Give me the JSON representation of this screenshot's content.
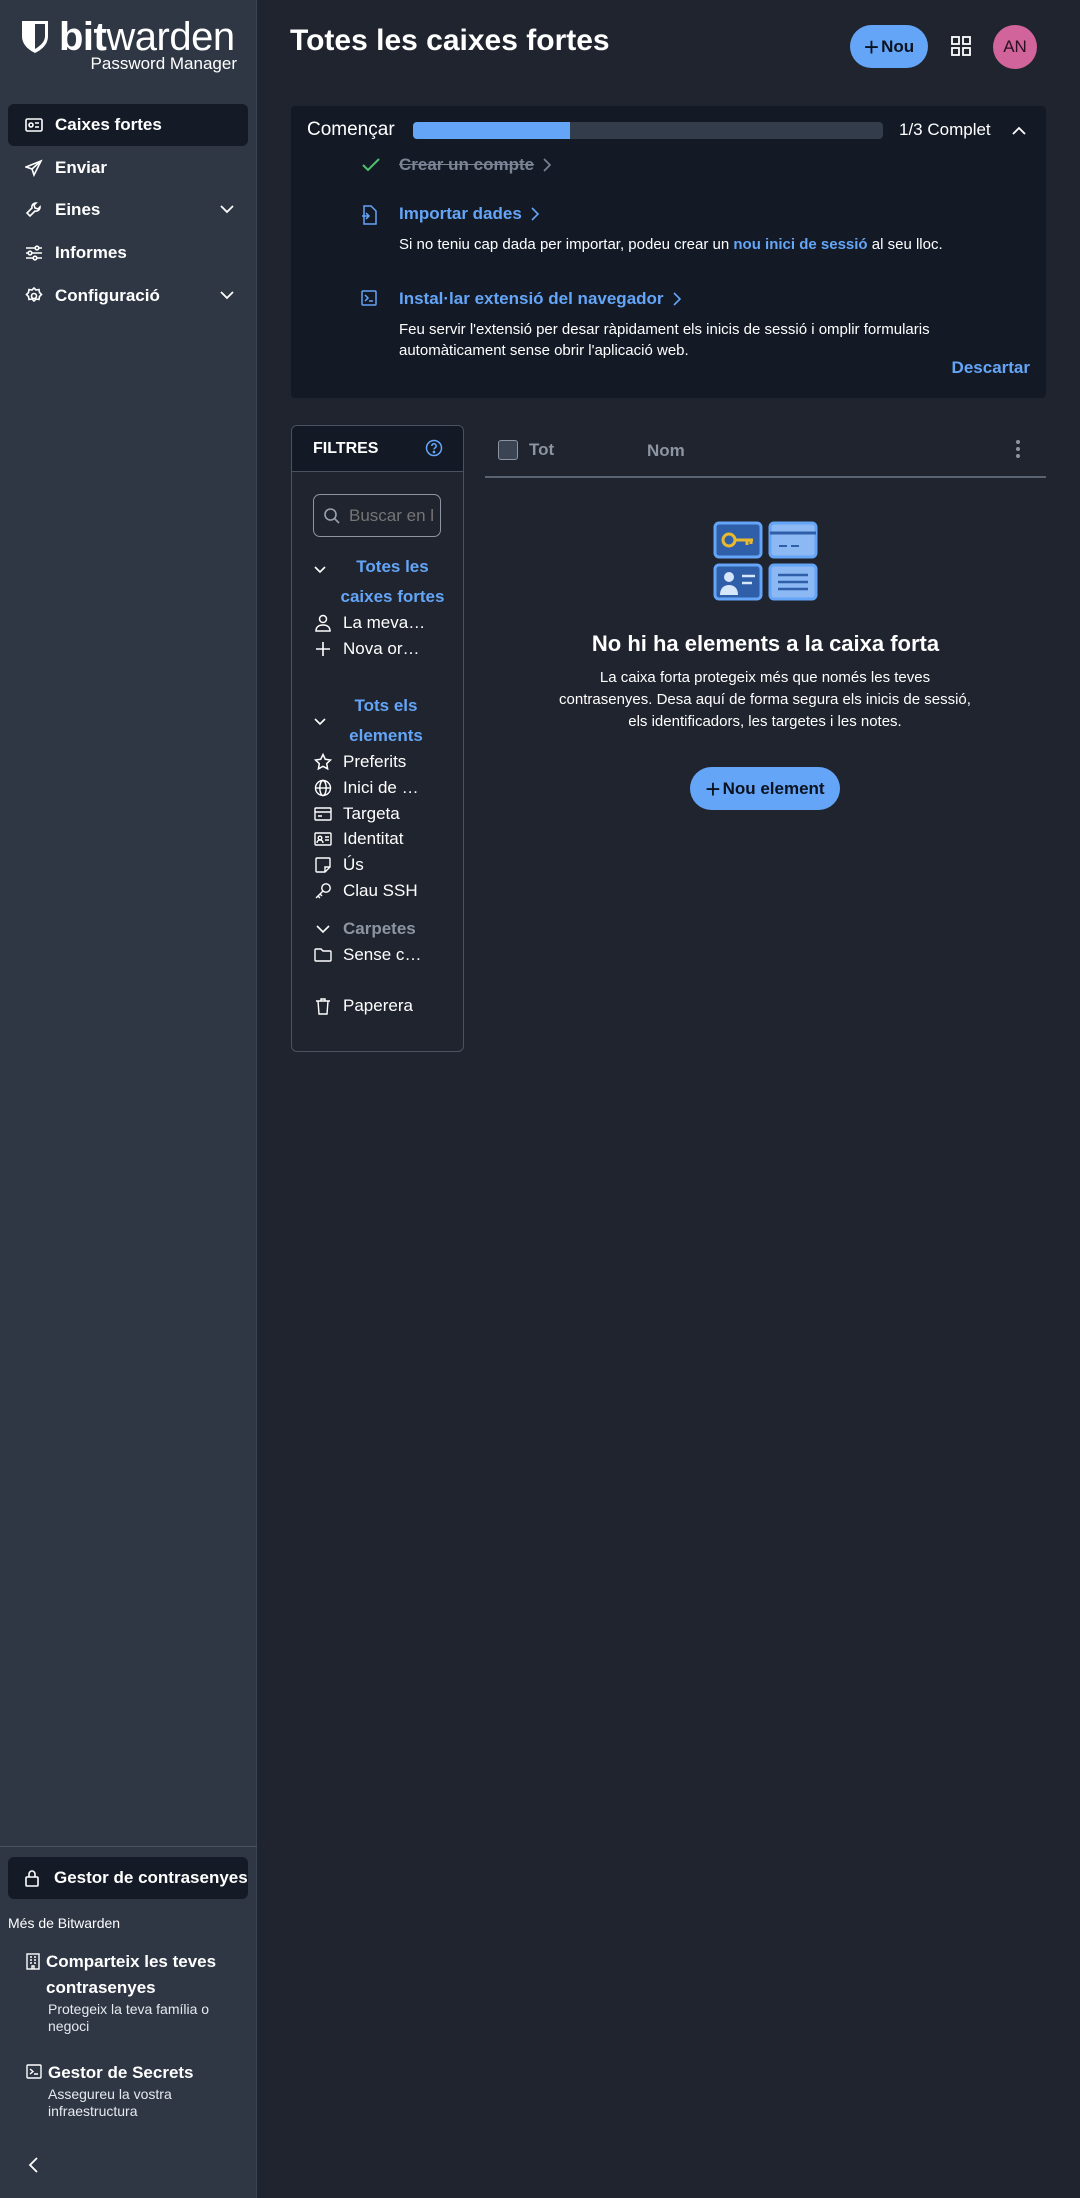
{
  "colors": {
    "accent": "#64a5f7",
    "sidebar": "#2f3744",
    "background": "#1f242e",
    "avatar": "#d0649b",
    "success": "#4fc06d"
  },
  "brand": {
    "word_bold": "bit",
    "word_light": "warden",
    "subtitle": "Password Manager",
    "icon": "shield-icon"
  },
  "sidebar": {
    "items": [
      {
        "label": "Caixes fortes",
        "icon": "vault-icon",
        "active": true
      },
      {
        "label": "Enviar",
        "icon": "send-icon"
      },
      {
        "label": "Eines",
        "icon": "wrench-icon",
        "expandable": true
      },
      {
        "label": "Informes",
        "icon": "sliders-icon"
      },
      {
        "label": "Configuració",
        "icon": "gear-icon",
        "expandable": true
      }
    ],
    "product_switcher": "Gestor de contrasenyes",
    "more_title": "Més de Bitwarden",
    "promos": [
      {
        "title": "Comparteix les teves contrasenyes",
        "desc": "Protegeix la teva família o negoci",
        "icon": "building-icon"
      },
      {
        "title": "Gestor de Secrets",
        "desc": "Assegureu la vostra infraestructura",
        "icon": "terminal-icon"
      }
    ]
  },
  "header": {
    "title": "Totes les caixes fortes",
    "new_label": "Nou",
    "avatar_initials": "AN"
  },
  "onboarding": {
    "title": "Començar",
    "progress": 0.333,
    "progress_label": "1/3 Complet",
    "tasks": [
      {
        "title": "Crear un compte",
        "done": true
      },
      {
        "title": "Importar dades",
        "desc_before": "Si no teniu cap dada per importar, podeu crear un ",
        "desc_link": "nou inici de sessió",
        "desc_after": " al seu lloc."
      },
      {
        "title": "Instal·lar extensió del navegador",
        "desc": "Feu servir l'extensió per desar ràpidament els inicis de sessió i omplir formularis automàticament sense obrir l'aplicació web."
      }
    ],
    "dismiss": "Descartar"
  },
  "filters": {
    "title": "FILTRES",
    "search_placeholder": "Buscar en la caixa forta",
    "vaults_header": "Totes les caixes fortes",
    "vaults": [
      {
        "label": "La meva caixa forta",
        "icon": "user-icon"
      },
      {
        "label": "Nova organització",
        "icon": "plus-icon"
      }
    ],
    "items_header": "Tots els elements",
    "types": [
      {
        "label": "Preferits",
        "icon": "star-icon"
      },
      {
        "label": "Inici de sessió",
        "icon": "globe-icon"
      },
      {
        "label": "Targeta",
        "icon": "card-icon"
      },
      {
        "label": "Identitat",
        "icon": "id-card-icon"
      },
      {
        "label": "Ús",
        "icon": "note-icon"
      },
      {
        "label": "Clau SSH",
        "icon": "key-icon"
      }
    ],
    "folders_header": "Carpetes",
    "folders": [
      {
        "label": "Sense carpeta",
        "icon": "folder-icon"
      }
    ],
    "trash": "Paperera"
  },
  "table": {
    "col_all": "Tot",
    "col_name": "Nom"
  },
  "empty": {
    "title": "No hi ha elements a la caixa forta",
    "desc": "La caixa forta protegeix més que només les teves contrasenyes. Desa aquí de forma segura els inicis de sessió, els identificadors, les targetes i les notes.",
    "button": "Nou element"
  }
}
